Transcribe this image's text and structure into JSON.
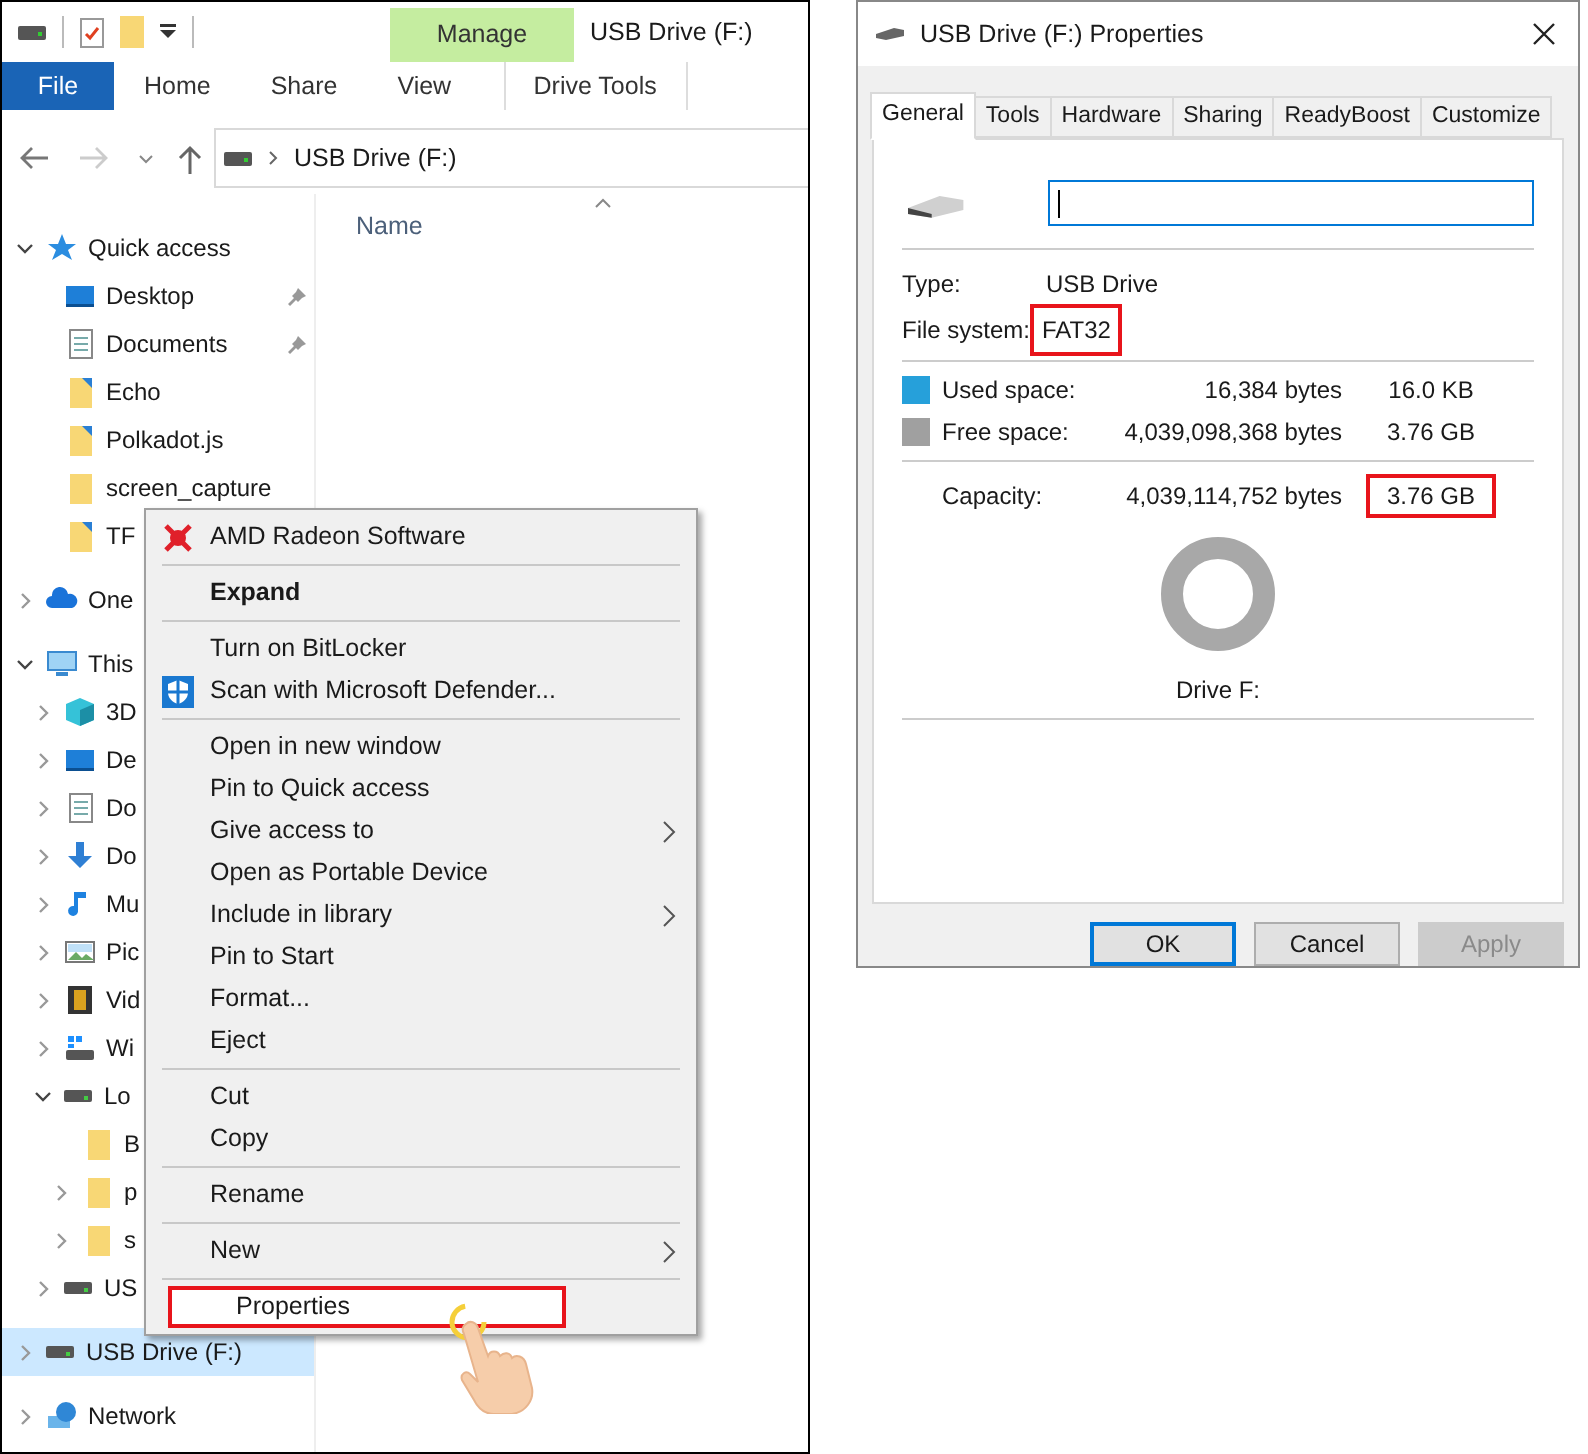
{
  "explorer": {
    "contextual_group": "Manage",
    "title": "USB Drive (F:)",
    "ribbon_tabs": [
      {
        "label": "File",
        "kind": "file"
      },
      {
        "label": "Home",
        "kind": "normal"
      },
      {
        "label": "Share",
        "kind": "normal"
      },
      {
        "label": "View",
        "kind": "normal"
      },
      {
        "label": "Drive Tools",
        "kind": "contextual"
      }
    ],
    "address": "USB Drive (F:)",
    "column_header": "Name",
    "nav_tree": [
      {
        "label": "Quick access",
        "kind": "star",
        "selected": false,
        "expanded": true,
        "children": [
          {
            "label": "Desktop",
            "kind": "desktop",
            "selected": false,
            "pinned": true
          },
          {
            "label": "Documents",
            "kind": "docs",
            "selected": false,
            "pinned": true
          },
          {
            "label": "Echo",
            "kind": "shortcut",
            "selected": false,
            "pinned": false
          },
          {
            "label": "Polkadot.js",
            "kind": "shortcut",
            "selected": false,
            "pinned": false
          },
          {
            "label": "screen_capture",
            "kind": "folder",
            "selected": false,
            "pinned": false
          },
          {
            "label": "TF",
            "kind": "shortcut",
            "selected": false,
            "pinned": false
          }
        ]
      },
      {
        "label": "One",
        "kind": "cloud",
        "selected": false,
        "expanded": false
      },
      {
        "label": "This",
        "kind": "pc",
        "selected": false,
        "expanded": true,
        "children": [
          {
            "label": "3D",
            "kind": "cube",
            "selected": false,
            "expanded": false
          },
          {
            "label": "De",
            "kind": "desktop",
            "selected": false,
            "expanded": false
          },
          {
            "label": "Do",
            "kind": "docs",
            "selected": false,
            "expanded": false
          },
          {
            "label": "Do",
            "kind": "download",
            "selected": false,
            "expanded": false
          },
          {
            "label": "Mu",
            "kind": "music",
            "selected": false,
            "expanded": false
          },
          {
            "label": "Pic",
            "kind": "pictures",
            "selected": false,
            "expanded": false
          },
          {
            "label": "Vid",
            "kind": "videos",
            "selected": false,
            "expanded": false
          },
          {
            "label": "Wi",
            "kind": "system",
            "selected": false,
            "expanded": false
          },
          {
            "label": "Lo",
            "kind": "drive",
            "selected": false,
            "expanded": true,
            "children": [
              {
                "label": "B",
                "kind": "folder",
                "selected": false
              },
              {
                "label": "p",
                "kind": "folder",
                "selected": false,
                "expanded": false
              },
              {
                "label": "s",
                "kind": "folder",
                "selected": false,
                "expanded": false
              }
            ]
          },
          {
            "label": "US",
            "kind": "drive",
            "selected": false,
            "expanded": false
          }
        ]
      },
      {
        "label": "USB Drive (F:)",
        "kind": "drive",
        "selected": true,
        "expanded": false
      },
      {
        "label": "Network",
        "kind": "network",
        "selected": false,
        "expanded": false
      }
    ]
  },
  "context_menu": [
    {
      "kind": "item",
      "label": "AMD Radeon Software",
      "default": false,
      "submenu": false,
      "selected": false,
      "annotated": false
    },
    {
      "kind": "separator"
    },
    {
      "kind": "item",
      "label": "Expand",
      "default": true,
      "submenu": false,
      "selected": false,
      "annotated": false
    },
    {
      "kind": "separator"
    },
    {
      "kind": "item",
      "label": "Turn on BitLocker",
      "default": false,
      "submenu": false,
      "selected": false,
      "annotated": false
    },
    {
      "kind": "item",
      "label": "Scan with Microsoft Defender...",
      "default": false,
      "submenu": false,
      "selected": false,
      "annotated": false
    },
    {
      "kind": "separator"
    },
    {
      "kind": "item",
      "label": "Open in new window",
      "default": false,
      "submenu": false,
      "selected": false,
      "annotated": false
    },
    {
      "kind": "item",
      "label": "Pin to Quick access",
      "default": false,
      "submenu": false,
      "selected": false,
      "annotated": false
    },
    {
      "kind": "item",
      "label": "Give access to",
      "default": false,
      "submenu": true,
      "selected": false,
      "annotated": false
    },
    {
      "kind": "item",
      "label": "Open as Portable Device",
      "default": false,
      "submenu": false,
      "selected": false,
      "annotated": false
    },
    {
      "kind": "item",
      "label": "Include in library",
      "default": false,
      "submenu": true,
      "selected": false,
      "annotated": false
    },
    {
      "kind": "item",
      "label": "Pin to Start",
      "default": false,
      "submenu": false,
      "selected": false,
      "annotated": false
    },
    {
      "kind": "item",
      "label": "Format...",
      "default": false,
      "submenu": false,
      "selected": false,
      "annotated": false
    },
    {
      "kind": "item",
      "label": "Eject",
      "default": false,
      "submenu": false,
      "selected": false,
      "annotated": false
    },
    {
      "kind": "separator"
    },
    {
      "kind": "item",
      "label": "Cut",
      "default": false,
      "submenu": false,
      "selected": false,
      "annotated": false
    },
    {
      "kind": "item",
      "label": "Copy",
      "default": false,
      "submenu": false,
      "selected": false,
      "annotated": false
    },
    {
      "kind": "separator"
    },
    {
      "kind": "item",
      "label": "Rename",
      "default": false,
      "submenu": false,
      "selected": false,
      "annotated": false
    },
    {
      "kind": "separator"
    },
    {
      "kind": "item",
      "label": "New",
      "default": false,
      "submenu": true,
      "selected": false,
      "annotated": false
    },
    {
      "kind": "separator"
    },
    {
      "kind": "item",
      "label": "Properties",
      "default": false,
      "submenu": false,
      "selected": true,
      "annotated": true
    }
  ],
  "properties": {
    "title": "USB Drive (F:) Properties",
    "tabs": [
      {
        "label": "General",
        "selected": true
      },
      {
        "label": "Tools",
        "selected": false
      },
      {
        "label": "Hardware",
        "selected": false
      },
      {
        "label": "Sharing",
        "selected": false
      },
      {
        "label": "ReadyBoost",
        "selected": false
      },
      {
        "label": "Customize",
        "selected": false
      }
    ],
    "type_label": "Type:",
    "type_value": "USB Drive",
    "fs_label": "File system:",
    "fs_value": "FAT32",
    "fs_annotated": true,
    "space": [
      {
        "label": "Used space:",
        "bytes": "16,384 bytes",
        "size": "16.0 KB",
        "color": "#26a0da"
      },
      {
        "label": "Free space:",
        "bytes": "4,039,098,368 bytes",
        "size": "3.76 GB",
        "color": "#a0a0a0"
      }
    ],
    "capacity": {
      "label": "Capacity:",
      "bytes": "4,039,114,752 bytes",
      "size": "3.76 GB",
      "annotated": true
    },
    "drive_label": "Drive F:",
    "buttons": [
      {
        "label": "OK",
        "default": true,
        "disabled": false
      },
      {
        "label": "Cancel",
        "default": false,
        "disabled": false
      },
      {
        "label": "Apply",
        "default": false,
        "disabled": true
      }
    ]
  }
}
